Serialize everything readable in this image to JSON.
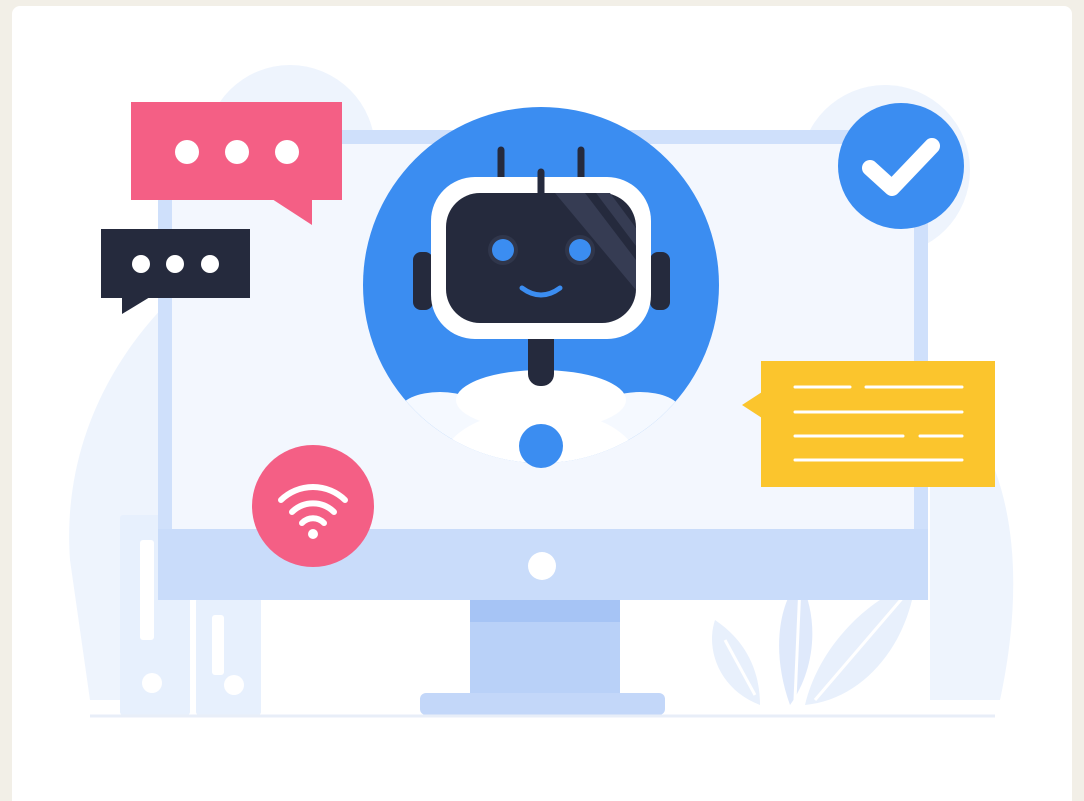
{
  "illustration": {
    "subject": "chatbot",
    "icons": [
      "robot-icon",
      "checkmark-icon",
      "wifi-icon",
      "typing-indicator-icon"
    ],
    "colors": {
      "page_background": "#f2efe7",
      "card": "#ffffff",
      "ghost": "#eef4fd",
      "monitor_frame": "#cfe0fb",
      "monitor_screen": "#f3f7fe",
      "monitor_stand": "#b9d1f8",
      "accent_blue": "#3b8df1",
      "pink": "#f45f85",
      "dark": "#252a3d",
      "yellow": "#fbc52d"
    }
  }
}
